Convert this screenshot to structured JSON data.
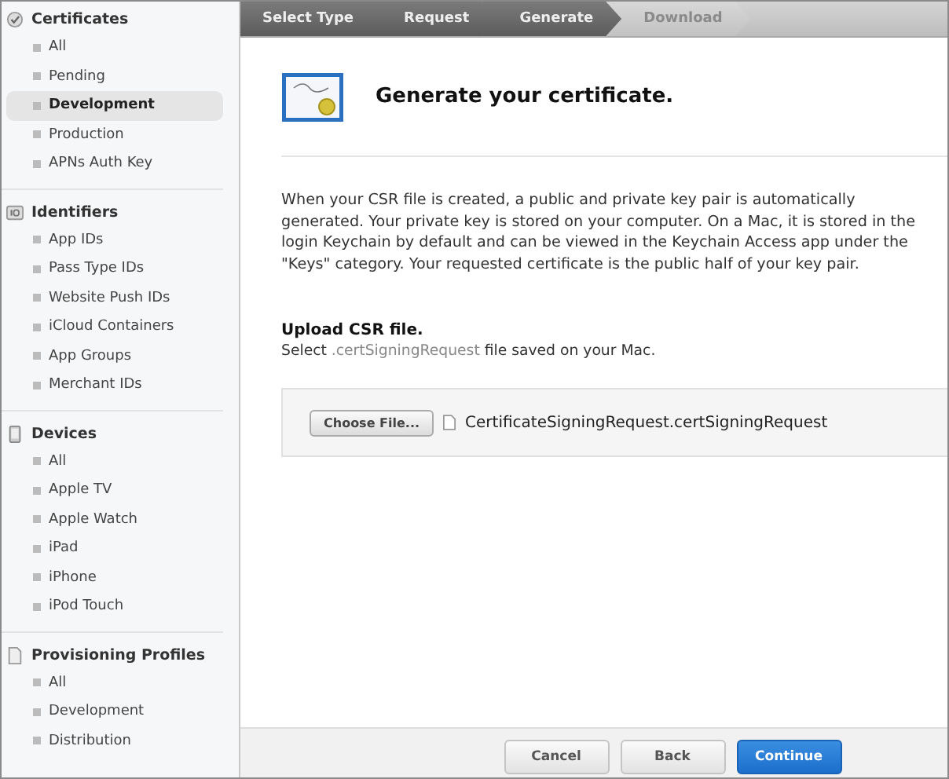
{
  "sidebar": {
    "sections": [
      {
        "title": "Certificates",
        "kind": "certificate",
        "items": [
          {
            "label": "All",
            "selected": false
          },
          {
            "label": "Pending",
            "selected": false
          },
          {
            "label": "Development",
            "selected": true
          },
          {
            "label": "Production",
            "selected": false
          },
          {
            "label": "APNs Auth Key",
            "selected": false
          }
        ]
      },
      {
        "title": "Identifiers",
        "kind": "id",
        "items": [
          {
            "label": "App IDs",
            "selected": false
          },
          {
            "label": "Pass Type IDs",
            "selected": false
          },
          {
            "label": "Website Push IDs",
            "selected": false
          },
          {
            "label": "iCloud Containers",
            "selected": false
          },
          {
            "label": "App Groups",
            "selected": false
          },
          {
            "label": "Merchant IDs",
            "selected": false
          }
        ]
      },
      {
        "title": "Devices",
        "kind": "device",
        "items": [
          {
            "label": "All",
            "selected": false
          },
          {
            "label": "Apple TV",
            "selected": false
          },
          {
            "label": "Apple Watch",
            "selected": false
          },
          {
            "label": "iPad",
            "selected": false
          },
          {
            "label": "iPhone",
            "selected": false
          },
          {
            "label": "iPod Touch",
            "selected": false
          }
        ]
      },
      {
        "title": "Provisioning Profiles",
        "kind": "document",
        "items": [
          {
            "label": "All",
            "selected": false
          },
          {
            "label": "Development",
            "selected": false
          },
          {
            "label": "Distribution",
            "selected": false
          }
        ]
      }
    ]
  },
  "steps": [
    {
      "label": "Select Type",
      "active": true
    },
    {
      "label": "Request",
      "active": true
    },
    {
      "label": "Generate",
      "active": true
    },
    {
      "label": "Download",
      "active": false
    }
  ],
  "heading": "Generate your certificate.",
  "description": "When your CSR file is created, a public and private key pair is automatically generated. Your private key is stored on your computer. On a Mac, it is stored in the login Keychain by default and can be viewed in the Keychain Access app under the \"Keys\" category. Your requested certificate is the public half of your key pair.",
  "upload": {
    "title": "Upload CSR file.",
    "hint_before": "Select",
    "hint_code": ".certSigningRequest",
    "hint_after": "file saved on your Mac.",
    "button": "Choose File...",
    "file_name": "CertificateSigningRequest.certSigningRequest"
  },
  "buttons": [
    {
      "label": "Cancel",
      "kind": "secondary"
    },
    {
      "label": "Back",
      "kind": "secondary"
    },
    {
      "label": "Continue",
      "kind": "primary"
    }
  ]
}
